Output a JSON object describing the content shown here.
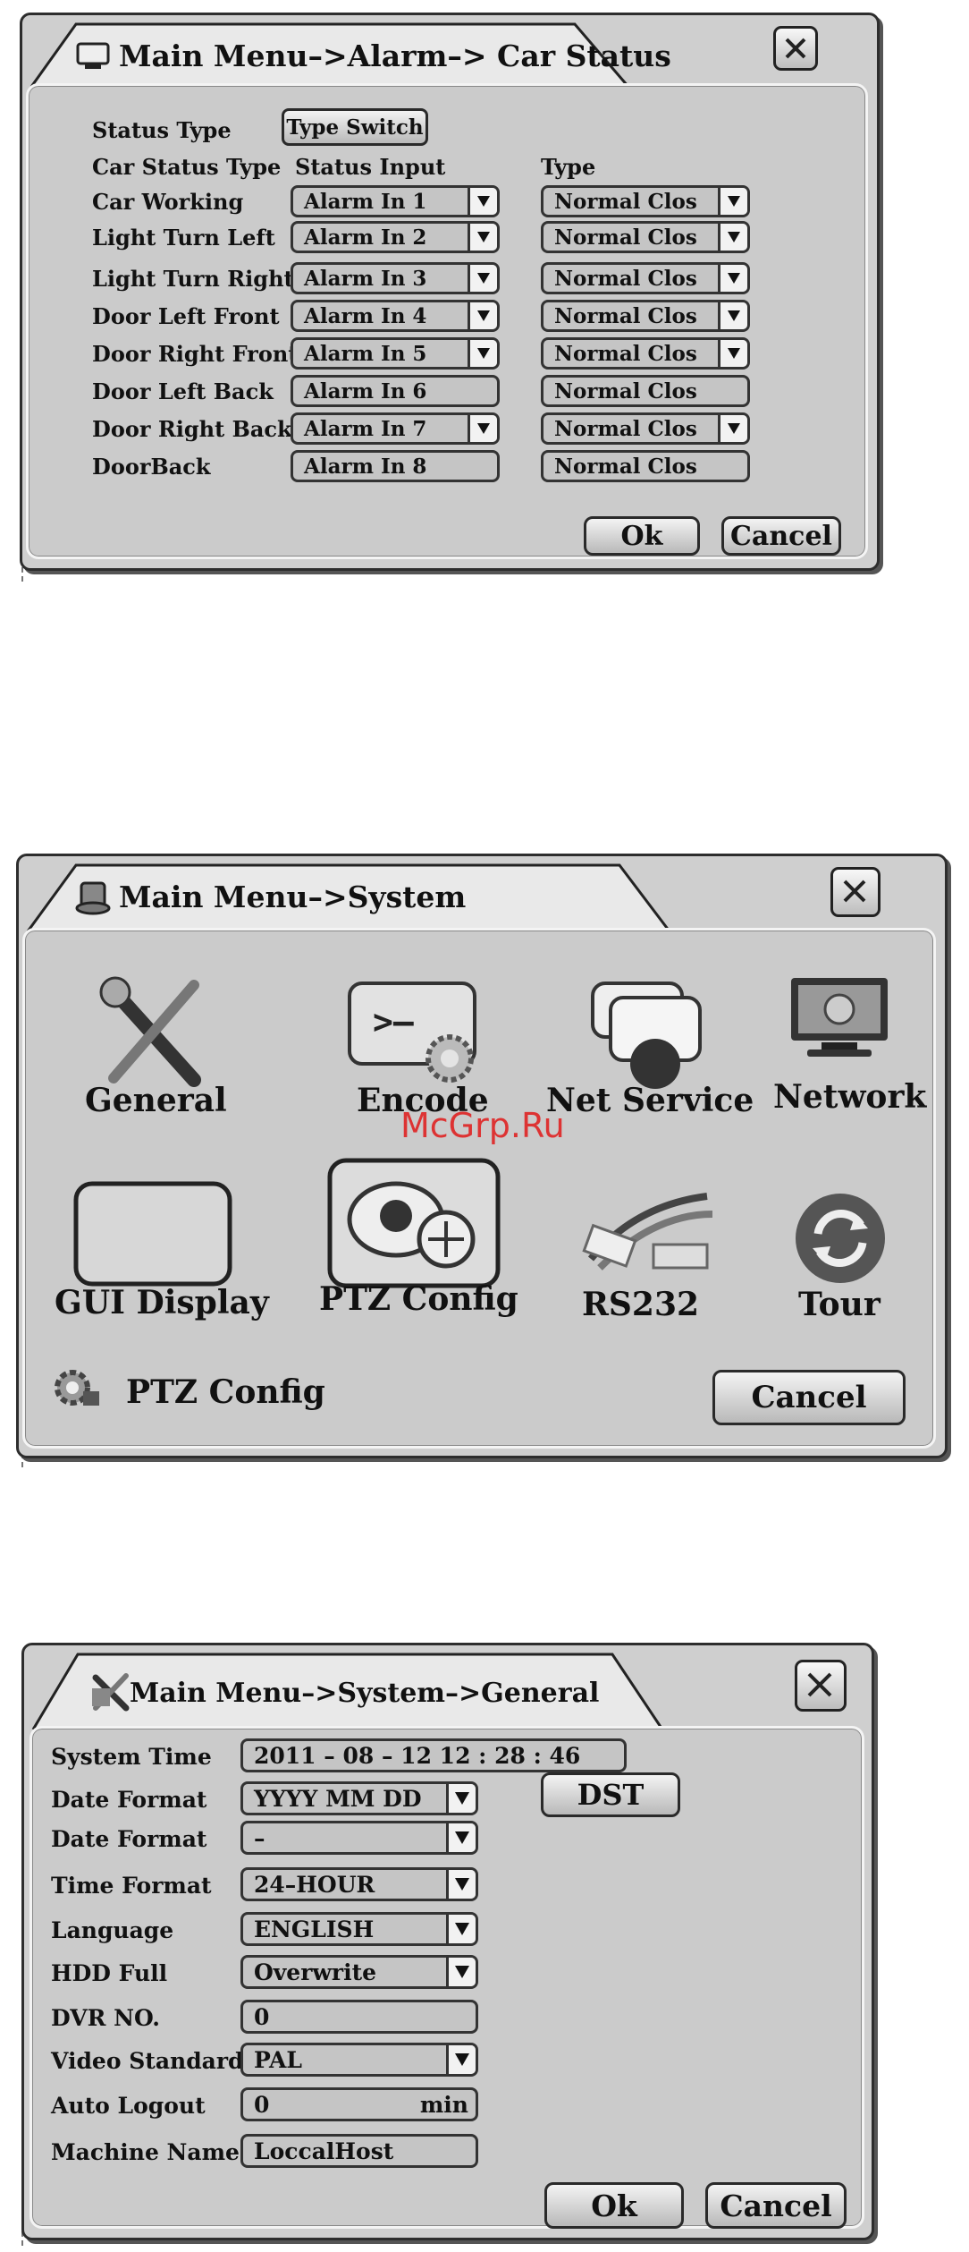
{
  "car_status": {
    "title": "Main Menu–>Alarm–> Car Status",
    "status_type_label": "Status  Type",
    "type_switch_label": "Type Switch",
    "col_car_status_type": "Car Status Type",
    "col_status_input": "Status Input",
    "col_type": "Type",
    "rows": [
      {
        "name": "Car Working",
        "input": "Alarm In 1",
        "type": "Normal Clos",
        "dropdown": true
      },
      {
        "name": "Light Turn Left",
        "input": "Alarm In 2",
        "type": "Normal Clos",
        "dropdown": true
      },
      {
        "name": "Light Turn Right",
        "input": "Alarm In 3",
        "type": "Normal Clos",
        "dropdown": true
      },
      {
        "name": "Door Left Front",
        "input": "Alarm In 4",
        "type": "Normal Clos",
        "dropdown": true
      },
      {
        "name": "Door  Right  Front",
        "input": "Alarm In 5",
        "type": "Normal Clos",
        "dropdown": true
      },
      {
        "name": "Door Left Back",
        "input": "Alarm In 6",
        "type": "Normal Clos",
        "dropdown": false
      },
      {
        "name": "Door Right Back",
        "input": "Alarm In 7",
        "type": "Normal Clos",
        "dropdown": true
      },
      {
        "name": "DoorBack",
        "input": "Alarm In 8",
        "type": "Normal Clos",
        "dropdown": false
      }
    ],
    "ok_label": "Ok",
    "cancel_label": "Cancel"
  },
  "system": {
    "title": "Main Menu–>System",
    "items": [
      "General",
      "Encode",
      "Net Service",
      "Network",
      "GUI Display",
      "PTZ Config",
      "RS232",
      "Tour"
    ],
    "status_label": "PTZ Config",
    "cancel_label": "Cancel"
  },
  "general": {
    "title": "Main Menu–>System–>General",
    "system_time_label": "System Time",
    "system_time_value": "2011 – 08 – 12     12  :  28  :  46",
    "date_format_label": "Date Format",
    "date_format_value": "YYYY  MM  DD",
    "date_sep_label": "Date Format",
    "date_sep_value": "–",
    "dst_label": "DST",
    "time_format_label": "Time Format",
    "time_format_value": "24–HOUR",
    "language_label": "Language",
    "language_value": "ENGLISH",
    "hdd_full_label": "HDD Full",
    "hdd_full_value": "Overwrite",
    "dvr_no_label": "DVR NO.",
    "dvr_no_value": "0",
    "video_standard_label": "Video Standard",
    "video_standard_value": "PAL",
    "auto_logout_label": "Auto Logout",
    "auto_logout_value": "0",
    "auto_logout_unit": "min",
    "machine_name_label": "Machine Name",
    "machine_name_value": "LoccalHost",
    "ok_label": "Ok",
    "cancel_label": "Cancel"
  },
  "watermark": "McGrp.Ru"
}
